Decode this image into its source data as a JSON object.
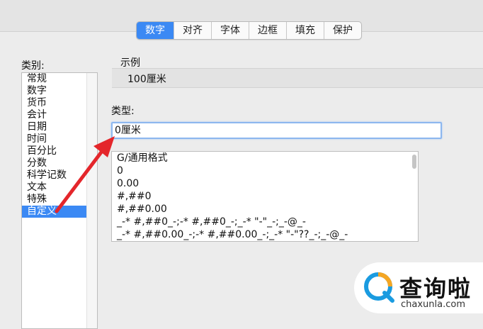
{
  "tabs": [
    {
      "label": "数字",
      "active": true
    },
    {
      "label": "对齐"
    },
    {
      "label": "字体"
    },
    {
      "label": "边框"
    },
    {
      "label": "填充"
    },
    {
      "label": "保护"
    }
  ],
  "category": {
    "label": "类别:",
    "items": [
      "常规",
      "数字",
      "货币",
      "会计",
      "日期",
      "时间",
      "百分比",
      "分数",
      "科学记数",
      "文本",
      "特殊",
      "自定义"
    ],
    "selected": "自定义"
  },
  "sample": {
    "label": "示例",
    "value": "100厘米"
  },
  "type": {
    "label": "类型:",
    "input_value": "0厘米"
  },
  "formats": [
    "G/通用格式",
    "0",
    "0.00",
    "#,##0",
    "#,##0.00",
    "_-* #,##0_-;-* #,##0_-;_-* \"-\"_-;_-@_-",
    "_-* #,##0.00_-;-* #,##0.00_-;_-* \"-\"??_-;_-@_-"
  ],
  "watermark": {
    "text": "查询啦",
    "url": "chaxunla.com"
  },
  "colors": {
    "accent": "#3b89f4",
    "arrow": "#e4262b"
  }
}
